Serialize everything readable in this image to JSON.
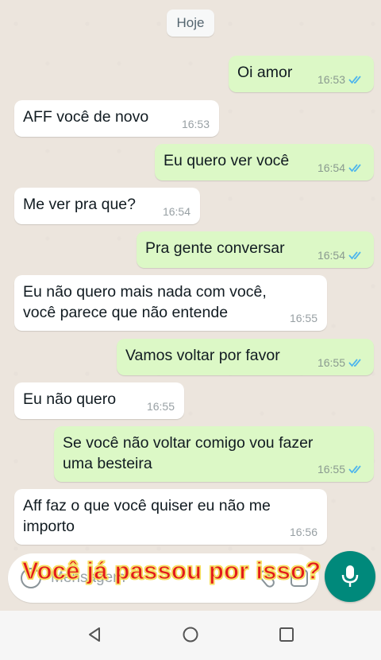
{
  "chat": {
    "date_separator": "Hoje",
    "messages": [
      {
        "text": "Oi amor",
        "time": "16:53",
        "direction": "out",
        "status": "read"
      },
      {
        "text": "AFF você de novo",
        "time": "16:53",
        "direction": "in"
      },
      {
        "text": "Eu quero ver você",
        "time": "16:54",
        "direction": "out",
        "status": "read"
      },
      {
        "text": "Me ver pra que?",
        "time": "16:54",
        "direction": "in"
      },
      {
        "text": "Pra gente conversar",
        "time": "16:54",
        "direction": "out",
        "status": "read"
      },
      {
        "text": "Eu não quero mais nada com você,\nvocê parece que não entende",
        "time": "16:55",
        "direction": "in"
      },
      {
        "text": "Vamos voltar por favor",
        "time": "16:55",
        "direction": "out",
        "status": "read"
      },
      {
        "text": "Eu não quero",
        "time": "16:55",
        "direction": "in"
      },
      {
        "text": "Se você não voltar comigo vou fazer\numa besteira",
        "time": "16:55",
        "direction": "out",
        "status": "read"
      },
      {
        "text": "Aff faz o que você quiser eu não me\nimporto",
        "time": "16:56",
        "direction": "in"
      }
    ]
  },
  "input": {
    "placeholder": "Mensagem",
    "icons": [
      "emoji-icon",
      "attach-icon",
      "camera-icon"
    ]
  },
  "mic_button": {
    "icon": "microphone-icon"
  },
  "overlay_caption": "Você já passou por isso?",
  "navbar": {
    "icons": [
      "back-icon",
      "home-icon",
      "recents-icon"
    ]
  },
  "colors": {
    "outgoing_bubble": "#dcf8c6",
    "incoming_bubble": "#ffffff",
    "read_ticks": "#4fb6ec",
    "mic_button": "#00897b",
    "caption_text": "#e31b1b",
    "caption_outline": "#f6e16a"
  }
}
